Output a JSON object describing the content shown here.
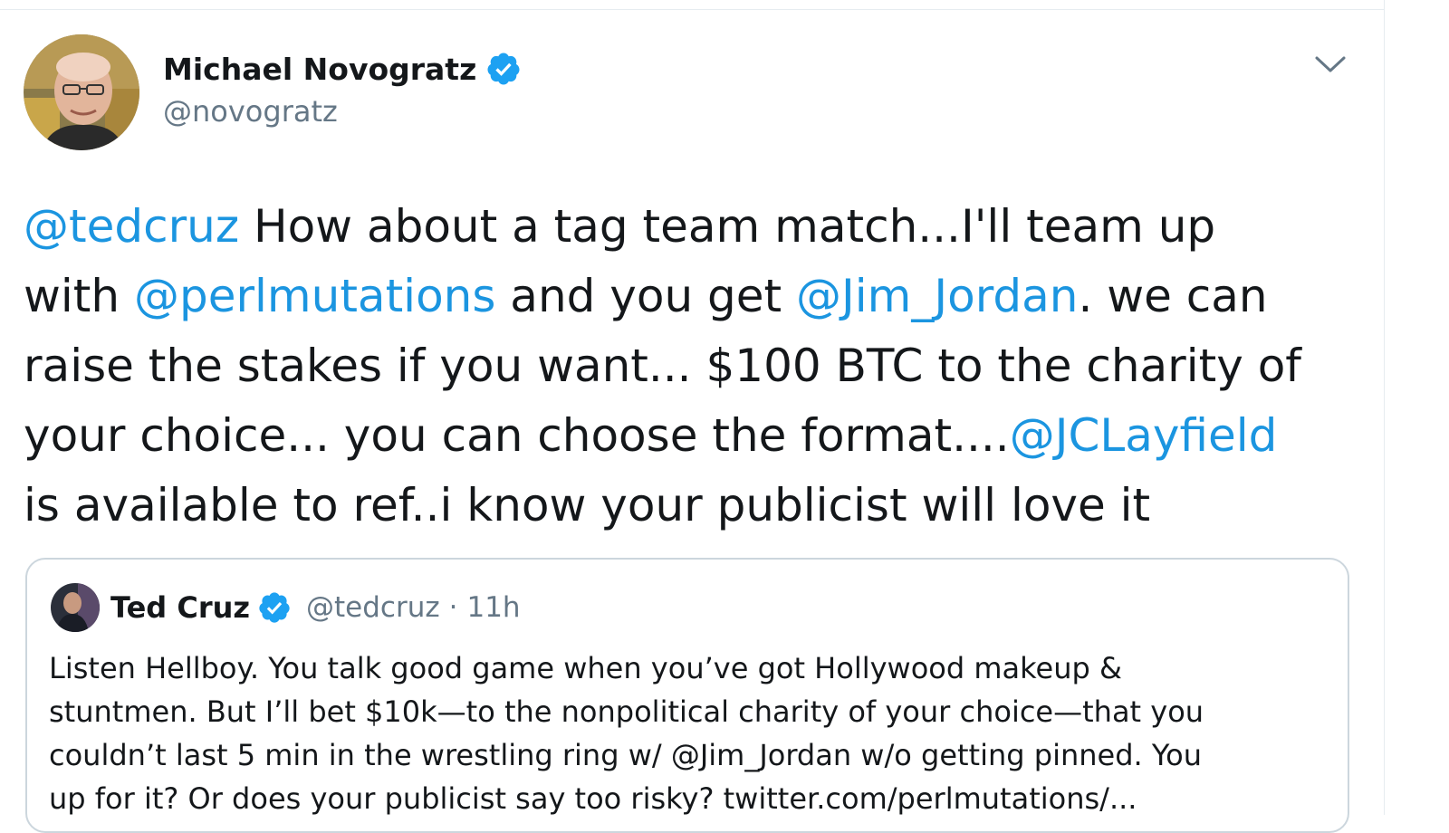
{
  "tweet": {
    "author": {
      "display_name": "Michael Novogratz",
      "handle": "@novogratz",
      "verified": true
    },
    "text_lines": [
      [
        {
          "t": "@tedcruz",
          "mention": true
        },
        {
          "t": "  How about  a tag team match...I'll team up",
          "mention": false
        }
      ],
      [
        {
          "t": "with ",
          "mention": false
        },
        {
          "t": "@perlmutations",
          "mention": true
        },
        {
          "t": " and you get ",
          "mention": false
        },
        {
          "t": "@Jim_Jordan",
          "mention": true
        },
        {
          "t": ".  we can",
          "mention": false
        }
      ],
      [
        {
          "t": "raise the stakes if you want...  $100 BTC to the charity of",
          "mention": false
        }
      ],
      [
        {
          "t": "your choice... you can choose the format....",
          "mention": false
        },
        {
          "t": "@JCLayfield",
          "mention": true
        }
      ],
      [
        {
          "t": "is available to ref..i know your publicist will love it",
          "mention": false
        }
      ]
    ],
    "menu_icon": "chevron-down-icon"
  },
  "quoted_tweet": {
    "display_name": "Ted Cruz",
    "handle": "@tedcruz",
    "separator": "·",
    "time": "11h",
    "verified": true,
    "text_lines": [
      "Listen Hellboy. You talk good game when you’ve got Hollywood makeup &",
      "stuntmen. But I’ll bet $10k—to the nonpolitical charity of your choice—that you",
      "couldn’t last 5 min in the wrestling ring w/ @Jim_Jordan w/o getting pinned. You",
      "up for it? Or does your publicist say too risky? twitter.com/perlmutations/..."
    ]
  },
  "colors": {
    "text": "#14171a",
    "secondary": "#657786",
    "link": "#1b95e0",
    "verified": "#1da1f2",
    "border": "#ccd6dd"
  }
}
